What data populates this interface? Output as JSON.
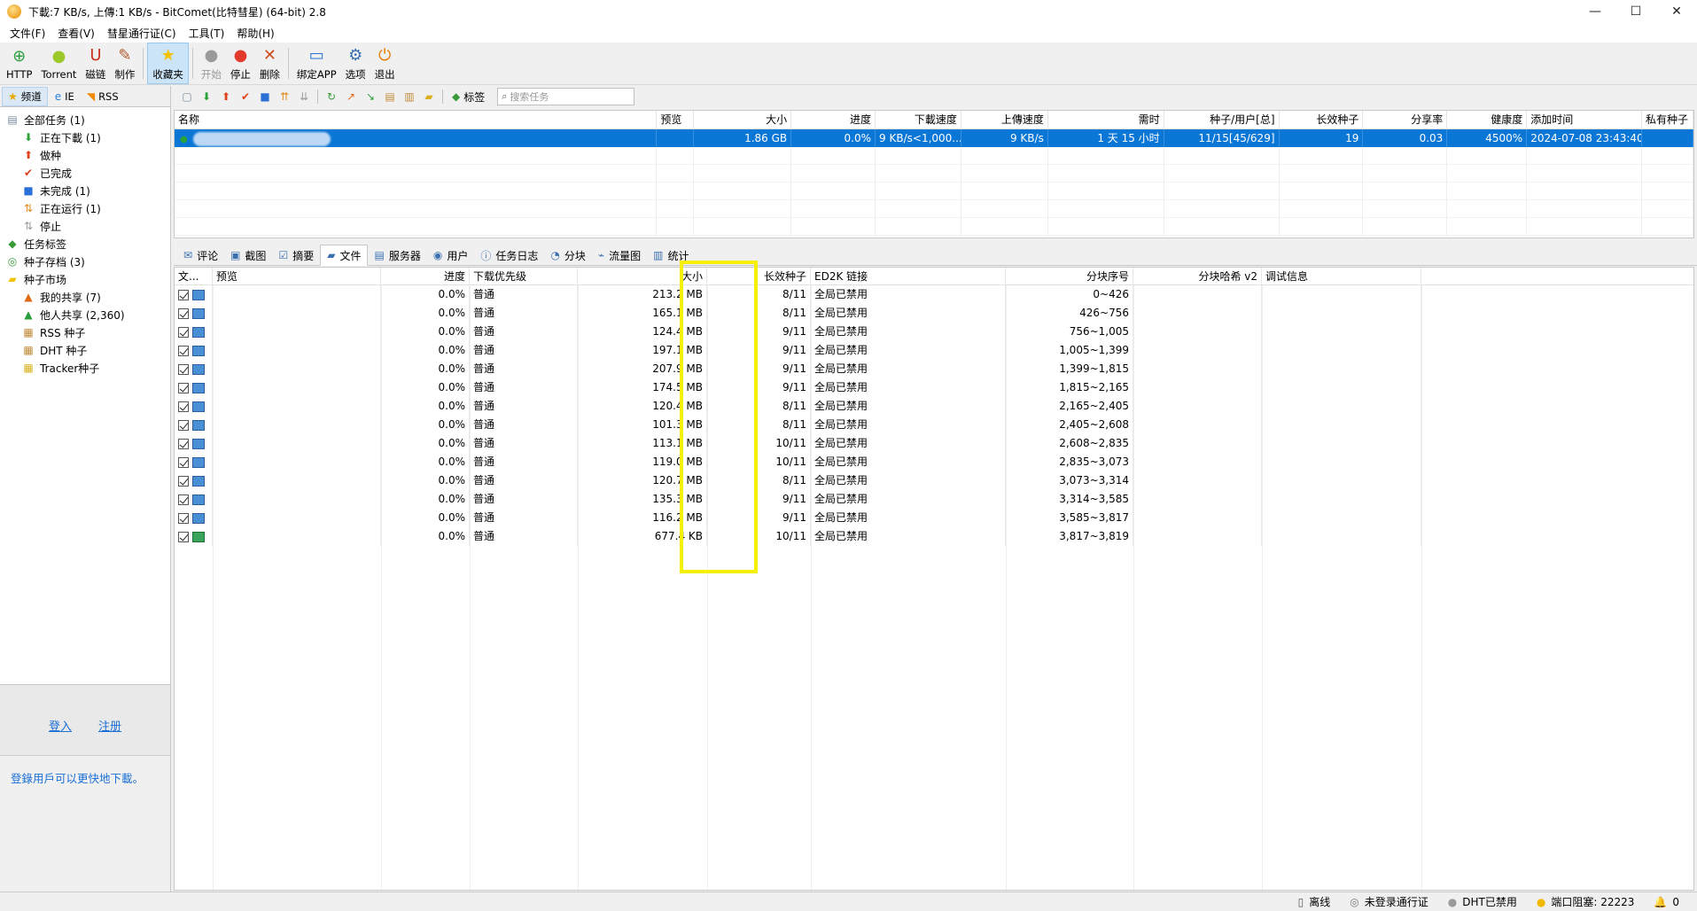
{
  "window": {
    "title": "下載:7 KB/s, 上傳:1 KB/s - BitComet(比特彗星) (64-bit) 2.8",
    "controls": {
      "minimize": "—",
      "maximize": "☐",
      "close": "✕"
    }
  },
  "menu": [
    "文件(F)",
    "查看(V)",
    "彗星通行证(C)",
    "工具(T)",
    "帮助(H)"
  ],
  "toolbar": [
    {
      "label": "HTTP",
      "icon": "http-add-icon",
      "glyph": "⊕",
      "color": "#2a9d3a"
    },
    {
      "label": "Torrent",
      "icon": "torrent-icon",
      "glyph": "●",
      "color": "#9bc92a"
    },
    {
      "label": "磁链",
      "icon": "magnet-icon",
      "glyph": "U",
      "color": "#c8321e"
    },
    {
      "label": "制作",
      "icon": "make-torrent-icon",
      "glyph": "✎",
      "color": "#b05a2a"
    },
    {
      "label": "收藏夹",
      "icon": "favorites-star-icon",
      "glyph": "★",
      "color": "#f2c200",
      "active": true
    },
    {
      "label": "开始",
      "icon": "start-icon",
      "glyph": "●",
      "color": "#9a9a9a",
      "disabled": true
    },
    {
      "label": "停止",
      "icon": "stop-icon",
      "glyph": "●",
      "color": "#e23a2a"
    },
    {
      "label": "删除",
      "icon": "delete-icon",
      "glyph": "✕",
      "color": "#d14a1a"
    },
    {
      "label": "绑定APP",
      "icon": "bind-app-icon",
      "glyph": "▭",
      "color": "#2a6fd6"
    },
    {
      "label": "选项",
      "icon": "options-icon",
      "glyph": "⚙",
      "color": "#3a6fb0"
    },
    {
      "label": "退出",
      "icon": "exit-icon",
      "glyph": "⏻",
      "color": "#e67a00"
    }
  ],
  "left_tabs": [
    {
      "label": "频道",
      "icon": "star-icon",
      "glyph": "★",
      "color": "#e6a800",
      "active": true
    },
    {
      "label": "IE",
      "icon": "ie-icon",
      "glyph": "e",
      "color": "#2a7fd6"
    },
    {
      "label": "RSS",
      "icon": "rss-icon",
      "glyph": "◥",
      "color": "#f08a00"
    }
  ],
  "tree": [
    {
      "label": "全部任务 (1)",
      "level": 0,
      "icon": "all-tasks-icon",
      "glyph": "▤",
      "color": "#7a8aa0"
    },
    {
      "label": "正在下載 (1)",
      "level": 1,
      "icon": "downloading-arrow-icon",
      "glyph": "⬇",
      "color": "#2aa23a"
    },
    {
      "label": "做种",
      "level": 1,
      "icon": "seeding-arrow-icon",
      "glyph": "⬆",
      "color": "#e0401a"
    },
    {
      "label": "已完成",
      "level": 1,
      "icon": "completed-check-icon",
      "glyph": "✔",
      "color": "#e0401a"
    },
    {
      "label": "未完成 (1)",
      "level": 1,
      "icon": "incomplete-icon",
      "glyph": "■",
      "color": "#2a6fd6"
    },
    {
      "label": "正在运行 (1)",
      "level": 1,
      "icon": "running-icon",
      "glyph": "⇅",
      "color": "#e08a1a"
    },
    {
      "label": "停止",
      "level": 1,
      "icon": "stopped-icon",
      "glyph": "⇅",
      "color": "#9a9a9a"
    },
    {
      "label": "任务标签",
      "level": 0,
      "icon": "task-tags-icon",
      "glyph": "◆",
      "color": "#3a9a3a"
    },
    {
      "label": "种子存档 (3)",
      "level": 0,
      "icon": "torrent-archive-icon",
      "glyph": "◎",
      "color": "#3a9a3a"
    },
    {
      "label": "种子市场",
      "level": 0,
      "icon": "torrent-market-folder-icon",
      "glyph": "▰",
      "color": "#f2c200"
    },
    {
      "label": "我的共享 (7)",
      "level": 1,
      "icon": "my-share-icon",
      "glyph": "▲",
      "color": "#e06a1a"
    },
    {
      "label": "他人共享 (2,360)",
      "level": 1,
      "icon": "others-share-icon",
      "glyph": "▲",
      "color": "#2a9d3a"
    },
    {
      "label": "RSS 种子",
      "level": 1,
      "icon": "rss-torrent-icon",
      "glyph": "▦",
      "color": "#c08a3a"
    },
    {
      "label": "DHT 种子",
      "level": 1,
      "icon": "dht-torrent-icon",
      "glyph": "▦",
      "color": "#c08a3a"
    },
    {
      "label": "Tracker种子",
      "level": 1,
      "icon": "tracker-torrent-icon",
      "glyph": "▦",
      "color": "#d8b020"
    }
  ],
  "login": {
    "login": "登入",
    "register": "注册",
    "hint": "登錄用戶可以更快地下載。"
  },
  "toolbar2": {
    "tags_label": "标签",
    "search_placeholder": "搜索任务"
  },
  "task_columns": [
    "名称",
    "预览",
    "大小",
    "进度",
    "下載速度",
    "上傳速度",
    "需时",
    "种子/用户[总]",
    "长效种子",
    "分享率",
    "健康度",
    "添加时间",
    "私有种子"
  ],
  "task_rows": [
    {
      "name": "",
      "preview": "",
      "size": "1.86 GB",
      "progress": "0.0%",
      "down_speed": "9 KB/s<1,000...",
      "up_speed": "9 KB/s",
      "eta": "1 天 15 小时",
      "seeds_peers": "11/15[45/629]",
      "long_seeds": "19",
      "share_ratio": "0.03",
      "health": "4500%",
      "added": "2024-07-08 23:43:40",
      "private": ""
    }
  ],
  "detail_tabs": [
    {
      "label": "评论",
      "icon": "comment-icon",
      "glyph": "✉"
    },
    {
      "label": "截图",
      "icon": "screenshot-icon",
      "glyph": "▣"
    },
    {
      "label": "摘要",
      "icon": "summary-icon",
      "glyph": "☑"
    },
    {
      "label": "文件",
      "icon": "files-folder-icon",
      "glyph": "▰",
      "active": true
    },
    {
      "label": "服务器",
      "icon": "server-icon",
      "glyph": "▤"
    },
    {
      "label": "用户",
      "icon": "users-icon",
      "glyph": "◉"
    },
    {
      "label": "任务日志",
      "icon": "task-log-icon",
      "glyph": "ⓘ"
    },
    {
      "label": "分块",
      "icon": "pieces-icon",
      "glyph": "◔"
    },
    {
      "label": "流量图",
      "icon": "traffic-graph-icon",
      "glyph": "⌁"
    },
    {
      "label": "统计",
      "icon": "statistics-icon",
      "glyph": "▥"
    }
  ],
  "file_columns": [
    "文...",
    "预览",
    "进度",
    "下载优先级",
    "大小",
    "长效种子",
    "ED2K 链接",
    "分块序号",
    "分块哈希 v2",
    "调试信息"
  ],
  "files": [
    {
      "progress": "0.0%",
      "priority": "普通",
      "size": "213.2 MB",
      "long_seeds": "8/11",
      "ed2k": "全局已禁用",
      "pieces": "0~426",
      "type": "video"
    },
    {
      "progress": "0.0%",
      "priority": "普通",
      "size": "165.1 MB",
      "long_seeds": "8/11",
      "ed2k": "全局已禁用",
      "pieces": "426~756",
      "type": "video"
    },
    {
      "progress": "0.0%",
      "priority": "普通",
      "size": "124.4 MB",
      "long_seeds": "9/11",
      "ed2k": "全局已禁用",
      "pieces": "756~1,005",
      "type": "video"
    },
    {
      "progress": "0.0%",
      "priority": "普通",
      "size": "197.1 MB",
      "long_seeds": "9/11",
      "ed2k": "全局已禁用",
      "pieces": "1,005~1,399",
      "type": "video"
    },
    {
      "progress": "0.0%",
      "priority": "普通",
      "size": "207.9 MB",
      "long_seeds": "9/11",
      "ed2k": "全局已禁用",
      "pieces": "1,399~1,815",
      "type": "video"
    },
    {
      "progress": "0.0%",
      "priority": "普通",
      "size": "174.5 MB",
      "long_seeds": "9/11",
      "ed2k": "全局已禁用",
      "pieces": "1,815~2,165",
      "type": "video"
    },
    {
      "progress": "0.0%",
      "priority": "普通",
      "size": "120.4 MB",
      "long_seeds": "8/11",
      "ed2k": "全局已禁用",
      "pieces": "2,165~2,405",
      "type": "video"
    },
    {
      "progress": "0.0%",
      "priority": "普通",
      "size": "101.3 MB",
      "long_seeds": "8/11",
      "ed2k": "全局已禁用",
      "pieces": "2,405~2,608",
      "type": "video"
    },
    {
      "progress": "0.0%",
      "priority": "普通",
      "size": "113.1 MB",
      "long_seeds": "10/11",
      "ed2k": "全局已禁用",
      "pieces": "2,608~2,835",
      "type": "video"
    },
    {
      "progress": "0.0%",
      "priority": "普通",
      "size": "119.0 MB",
      "long_seeds": "10/11",
      "ed2k": "全局已禁用",
      "pieces": "2,835~3,073",
      "type": "video"
    },
    {
      "progress": "0.0%",
      "priority": "普通",
      "size": "120.7 MB",
      "long_seeds": "8/11",
      "ed2k": "全局已禁用",
      "pieces": "3,073~3,314",
      "type": "video"
    },
    {
      "progress": "0.0%",
      "priority": "普通",
      "size": "135.3 MB",
      "long_seeds": "9/11",
      "ed2k": "全局已禁用",
      "pieces": "3,314~3,585",
      "type": "video"
    },
    {
      "progress": "0.0%",
      "priority": "普通",
      "size": "116.2 MB",
      "long_seeds": "9/11",
      "ed2k": "全局已禁用",
      "pieces": "3,585~3,817",
      "type": "video"
    },
    {
      "progress": "0.0%",
      "priority": "普通",
      "size": "677.4 KB",
      "long_seeds": "10/11",
      "ed2k": "全局已禁用",
      "pieces": "3,817~3,819",
      "type": "image"
    }
  ],
  "highlight_color": "#f5f000",
  "selection_color": "#0a76d6",
  "status": [
    {
      "label": "离线",
      "icon": "phone-offline-icon",
      "glyph": "▯",
      "color": "#555555"
    },
    {
      "label": "未登录通行证",
      "icon": "passport-icon",
      "glyph": "◎",
      "color": "#777777"
    },
    {
      "label": "DHT已禁用",
      "icon": "dht-status-dot-icon",
      "glyph": "●",
      "color": "#9a9a9a"
    },
    {
      "label": "端口阻塞: 22223",
      "icon": "port-status-dot-icon",
      "glyph": "●",
      "color": "#f2b800"
    },
    {
      "label": "0",
      "icon": "bell-icon",
      "glyph": "🔔",
      "color": "#666666"
    }
  ]
}
